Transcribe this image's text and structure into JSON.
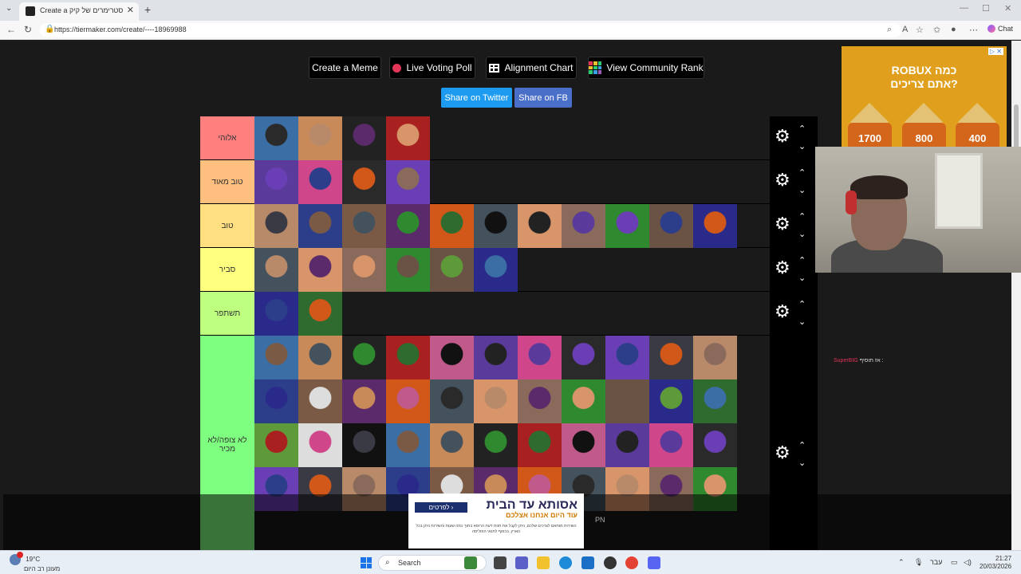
{
  "browser": {
    "tab_title": "Create a דירוג סטרימרים של קיק Tier",
    "url": "https://tiermaker.com/create/----18969988",
    "chat_label": "Chat"
  },
  "toolbar": {
    "create_meme": "Create a Meme",
    "live_voting": "Live Voting Poll",
    "alignment_chart": "Alignment Chart",
    "community_rank": "View Community Rank",
    "share_twitter": "Share on Twitter",
    "share_fb": "Share on FB"
  },
  "tiers": [
    {
      "label": "אלוהי",
      "color": "#ff7f7f",
      "items": 4
    },
    {
      "label": "טוב מאוד",
      "color": "#ffbf7f",
      "items": 4
    },
    {
      "label": "טוב",
      "color": "#ffdf7f",
      "items": 11
    },
    {
      "label": "סביר",
      "color": "#ffff7f",
      "items": 6
    },
    {
      "label": "תשתפר",
      "color": "#bfff7f",
      "items": 2
    },
    {
      "label": "לא צופה/לא מכיר",
      "color": "#7fff7f",
      "items": 44
    }
  ],
  "ads": {
    "robux_title_line1": "ROBUX כמה",
    "robux_title_line2": "אתם צריכים?",
    "robux_values": [
      "1700",
      "800",
      "400"
    ],
    "bottom_brand": "אסותא עד הבית",
    "bottom_sub": "עוד היום אנחנו אצלכם",
    "bottom_button": "לפרטים ›",
    "bottom_text": "השירות מותאם לצרכים שלכם, ניתן לקבל את חוות דעת הרופא בתוך כמה שעות והשירות ניתן בכל הארץ. בכפוף לתנאי הפוליסה",
    "pn": "PN"
  },
  "stream_chat": {
    "user": "SuperBIG",
    "message": "אז תוסיף :"
  },
  "taskbar": {
    "temperature": "19°C",
    "weather_desc": "מעונן רב היום",
    "search_label": "Search",
    "lang": "עבר",
    "time": "21:27",
    "date": "20/03/2026"
  },
  "colors": {
    "page_bg": "#1a1a1a",
    "twitter": "#1d9bf0",
    "facebook": "#4a6fc9",
    "ad_gold": "#e0a01d"
  }
}
